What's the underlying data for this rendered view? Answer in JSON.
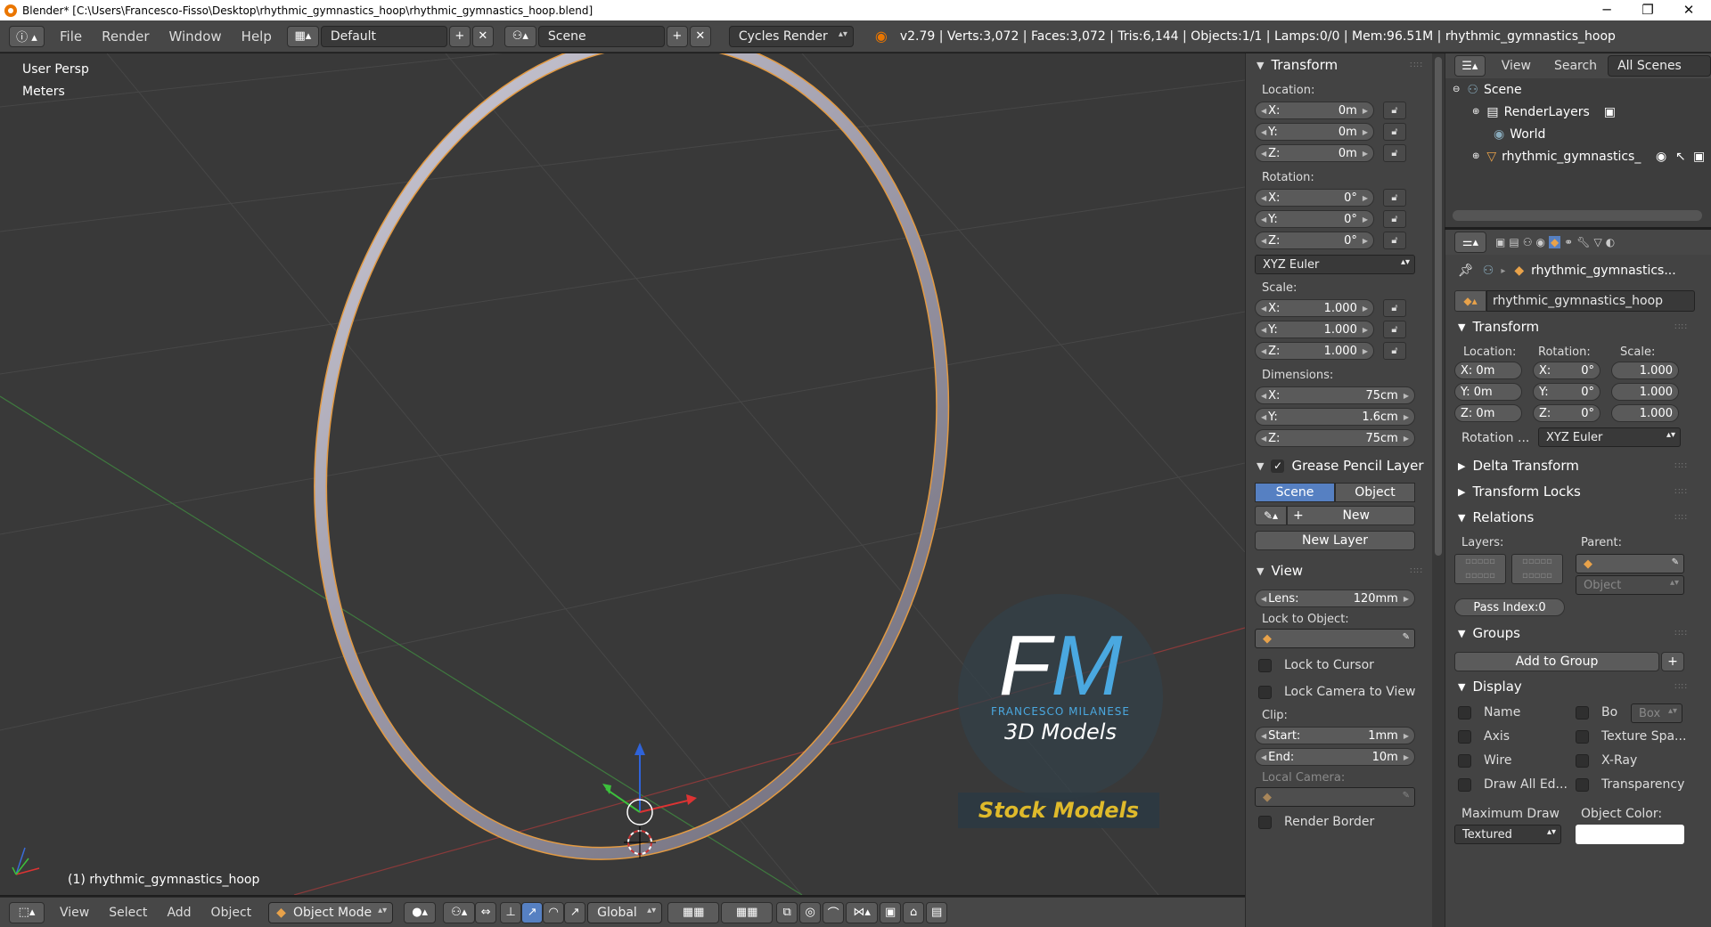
{
  "titlebar": {
    "title": "Blender* [C:\\Users\\Francesco-Fisso\\Desktop\\rhythmic_gymnastics_hoop\\rhythmic_gymnastics_hoop.blend]",
    "minimize": "─",
    "maximize": "❐",
    "close": "✕"
  },
  "info": {
    "menus": [
      "File",
      "Render",
      "Window",
      "Help"
    ],
    "layout": "Default",
    "scene": "Scene",
    "engine": "Cycles Render",
    "stats": "v2.79 | Verts:3,072 | Faces:3,072 | Tris:6,144 | Objects:1/1 | Lamps:0/0 | Mem:96.51M | rhythmic_gymnastics_hoop"
  },
  "viewport": {
    "view_name": "User Persp",
    "units": "Meters",
    "object_label": "(1) rhythmic_gymnastics_hoop",
    "watermark": {
      "letters": "FM",
      "name": "FRANCESCO MILANESE",
      "sub": "3D Models",
      "stock": "Stock Models"
    }
  },
  "footer": {
    "menus": [
      "View",
      "Select",
      "Add",
      "Object"
    ],
    "mode": "Object Mode",
    "orientation": "Global"
  },
  "npanel": {
    "transform": {
      "title": "Transform",
      "location_label": "Location:",
      "location": [
        {
          "axis": "X:",
          "value": "0m"
        },
        {
          "axis": "Y:",
          "value": "0m"
        },
        {
          "axis": "Z:",
          "value": "0m"
        }
      ],
      "rotation_label": "Rotation:",
      "rotation": [
        {
          "axis": "X:",
          "value": "0°"
        },
        {
          "axis": "Y:",
          "value": "0°"
        },
        {
          "axis": "Z:",
          "value": "0°"
        }
      ],
      "rotation_mode": "XYZ Euler",
      "scale_label": "Scale:",
      "scale": [
        {
          "axis": "X:",
          "value": "1.000"
        },
        {
          "axis": "Y:",
          "value": "1.000"
        },
        {
          "axis": "Z:",
          "value": "1.000"
        }
      ],
      "dimensions_label": "Dimensions:",
      "dimensions": [
        {
          "axis": "X:",
          "value": "75cm"
        },
        {
          "axis": "Y:",
          "value": "1.6cm"
        },
        {
          "axis": "Z:",
          "value": "75cm"
        }
      ]
    },
    "grease": {
      "title": "Grease Pencil Layer",
      "scene": "Scene",
      "object": "Object",
      "new": "New",
      "new_layer": "New Layer"
    },
    "view": {
      "title": "View",
      "lens_label": "Lens:",
      "lens": "120mm",
      "lock_to_object": "Lock to Object:",
      "lock_to_cursor": "Lock to Cursor",
      "lock_camera": "Lock Camera to View",
      "clip_label": "Clip:",
      "clip_start_label": "Start:",
      "clip_start": "1mm",
      "clip_end_label": "End:",
      "clip_end": "10m",
      "local_camera": "Local Camera:",
      "render_border": "Render Border"
    }
  },
  "outliner": {
    "view": "View",
    "search": "Search",
    "filter": "All Scenes",
    "items": [
      "Scene",
      "RenderLayers",
      "World",
      "rhythmic_gymnastics_"
    ]
  },
  "properties": {
    "breadcrumb": "rhythmic_gymnastics...",
    "object_name": "rhythmic_gymnastics_hoop",
    "transform": {
      "title": "Transform",
      "location_label": "Location:",
      "rotation_label": "Rotation:",
      "scale_label": "Scale:",
      "loc": [
        "X: 0m",
        "Y: 0m",
        "Z: 0m"
      ],
      "rot": [
        "X:",
        "Y:",
        "Z:"
      ],
      "rot_vals": [
        "0°",
        "0°",
        "0°"
      ],
      "scale": [
        "1.000",
        "1.000",
        "1.000"
      ],
      "rotation_mode_label": "Rotation ...",
      "rotation_mode": "XYZ Euler"
    },
    "delta": "Delta Transform",
    "locks": "Transform Locks",
    "relations": {
      "title": "Relations",
      "layers": "Layers:",
      "parent": "Parent:",
      "parent_type": "Object",
      "pass_index": "Pass Index:0"
    },
    "groups": {
      "title": "Groups",
      "add": "Add to Group"
    },
    "display": {
      "title": "Display",
      "name": "Name",
      "bo": "Bo",
      "box": "Box",
      "axis": "Axis",
      "texture_space": "Texture Spa...",
      "wire": "Wire",
      "xray": "X-Ray",
      "draw_all": "Draw All Ed...",
      "transparency": "Transparency",
      "max_draw": "Maximum Draw",
      "obj_color": "Object Color:",
      "textured": "Textured"
    }
  }
}
